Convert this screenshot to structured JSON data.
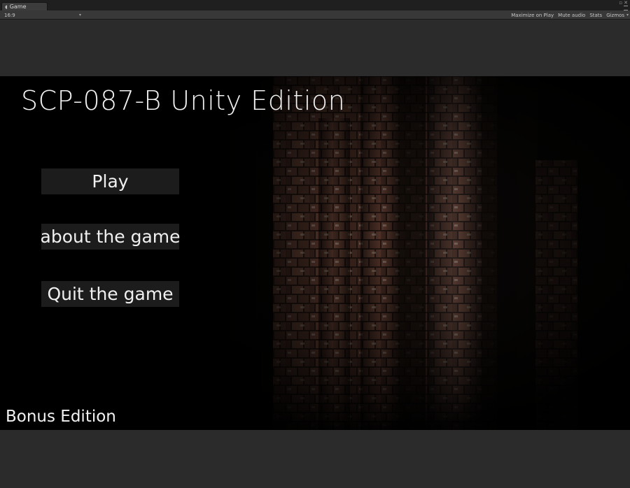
{
  "editor": {
    "tab_label": "Game",
    "tab_icon": "unity-game-icon"
  },
  "toolbar": {
    "aspect_label": "16:9",
    "maximize_label": "Maximize on Play",
    "mute_label": "Mute audio",
    "stats_label": "Stats",
    "gizmos_label": "Gizmos"
  },
  "game": {
    "title": "SCP-087-B Unity Edition",
    "menu": {
      "play": "Play",
      "about": "about the game",
      "quit": "Quit the game"
    },
    "footer": "Bonus Edition"
  },
  "colors": {
    "editor_bg": "#2b2b2b",
    "toolbar_bg": "#383838",
    "button_bg": "#1e1e1e",
    "text": "#f2f2f2",
    "brick": "#5a3a30"
  }
}
